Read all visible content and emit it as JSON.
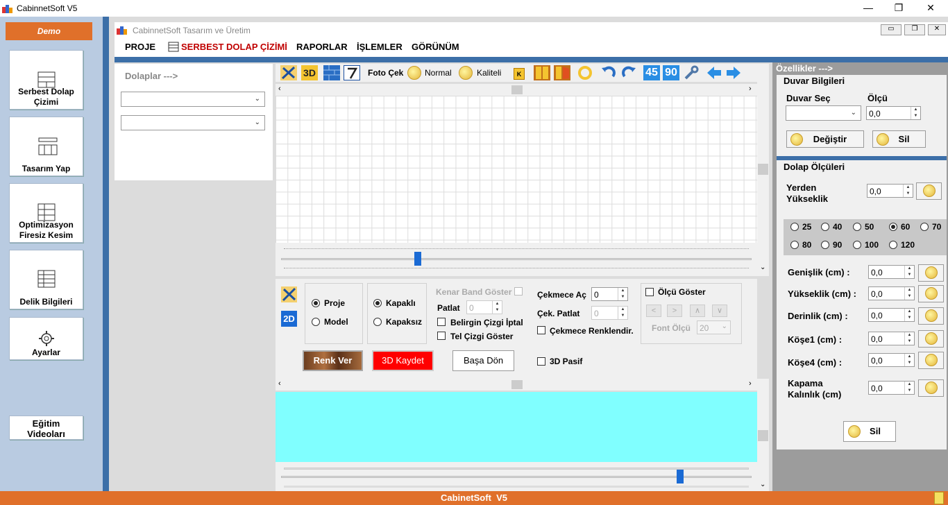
{
  "window": {
    "title": "CabinnetSoft V5",
    "controls": {
      "minimize": "—",
      "restore": "❐",
      "close": "✕"
    }
  },
  "inner_window": {
    "title": "CabinnetSoft Tasarım ve Üretim"
  },
  "sidebar": {
    "demo": "Demo",
    "items": [
      {
        "label": "Serbest Dolap Çizimi"
      },
      {
        "label": "Tasarım Yap"
      },
      {
        "label": "Optimizasyon Firesiz Kesim"
      },
      {
        "label": "Delik Bilgileri"
      },
      {
        "label": "Ayarlar"
      },
      {
        "label": "Eğitim Videoları"
      }
    ]
  },
  "menu": {
    "items": [
      "PROJE",
      "SERBEST DOLAP ÇİZİMİ",
      "RAPORLAR",
      "İŞLEMLER",
      "GÖRÜNÜM"
    ]
  },
  "left_panel": {
    "title": "Dolaplar --->"
  },
  "toolbar": {
    "btn_3d": "3D",
    "foto_cek": "Foto Çek",
    "normal": "Normal",
    "kaliteli": "Kaliteli",
    "k": "K",
    "deg45": "45",
    "deg90": "90"
  },
  "controls": {
    "btn_2d": "2D",
    "proje": "Proje",
    "model": "Model",
    "kapakli": "Kapaklı",
    "kapaksiz": "Kapaksız",
    "kenar_band": "Kenar Band Göster",
    "patlat": "Patlat",
    "patlat_val": "0",
    "belirgin": "Belirgin Çizgi İptal",
    "tel_cizgi": "Tel Çizgi Göster",
    "cekmece_ac": "Çekmece Aç",
    "cekmece_ac_val": "0",
    "cek_patlat": "Çek. Patlat",
    "cek_patlat_val": "0",
    "cekmece_renk": "Çekmece Renklendir.",
    "olcu_goster": "Ölçü Göster",
    "nav": [
      "<",
      ">",
      "∧",
      "∨"
    ],
    "font_olcu": "Font Ölçü",
    "font_val": "20",
    "renk_ver": "Renk Ver",
    "kaydet_3d": "3D Kaydet",
    "basa_don": "Başa Dön",
    "pasif_3d": "3D Pasif"
  },
  "properties": {
    "header": "Özellikler --->",
    "duvar_bilgileri": "Duvar Bilgileri",
    "duvar_sec": "Duvar Seç",
    "olcu": "Ölçü",
    "olcu_val": "0,0",
    "degistir": "Değiştir",
    "sil": "Sil",
    "dolap_olculeri": "Dolap Ölçüleri",
    "yerden": "Yerden Yükseklik",
    "yerden_val": "0,0",
    "sizes": [
      "25",
      "40",
      "50",
      "60",
      "70",
      "80",
      "90",
      "100",
      "120"
    ],
    "selected_size": "60",
    "fields": [
      {
        "label": "Genişlik (cm) :",
        "value": "0,0"
      },
      {
        "label": "Yükseklik (cm) :",
        "value": "0,0"
      },
      {
        "label": "Derinlik (cm) :",
        "value": "0,0"
      },
      {
        "label": "Köşe1 (cm) :",
        "value": "0,0"
      },
      {
        "label": "Köşe4 (cm) :",
        "value": "0,0"
      },
      {
        "label": "Kapama Kalınlık (cm)",
        "value": "0,0"
      }
    ],
    "sil_bottom": "Sil"
  },
  "statusbar": {
    "text": "CabinetSoft  V5"
  },
  "colors": {
    "accent": "#e0702a",
    "blue": "#3c6fa8",
    "cyan": "#80ffff",
    "red": "#ff0000"
  }
}
